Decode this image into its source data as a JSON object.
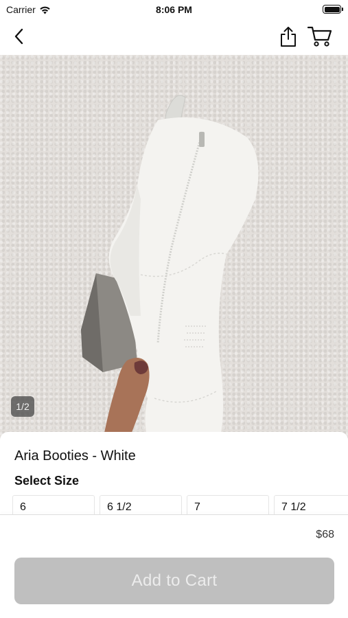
{
  "status_bar": {
    "carrier": "Carrier",
    "time": "8:06 PM",
    "icons": [
      "wifi-icon",
      "battery-icon"
    ]
  },
  "nav": {
    "icons": [
      "back-chevron-icon",
      "share-icon",
      "cart-icon"
    ]
  },
  "product": {
    "title": "Aria Booties - White",
    "image_indicator": "1/2",
    "image_count": 2,
    "current_image": 1
  },
  "size_selector": {
    "label": "Select Size",
    "options": [
      "6",
      "6 1/2",
      "7",
      "7 1/2"
    ]
  },
  "price": "$68",
  "add_to_cart_label": "Add to Cart",
  "colors": {
    "button_disabled": "#bfbfbf",
    "button_text": "#ececec",
    "background": "#ffffff"
  }
}
